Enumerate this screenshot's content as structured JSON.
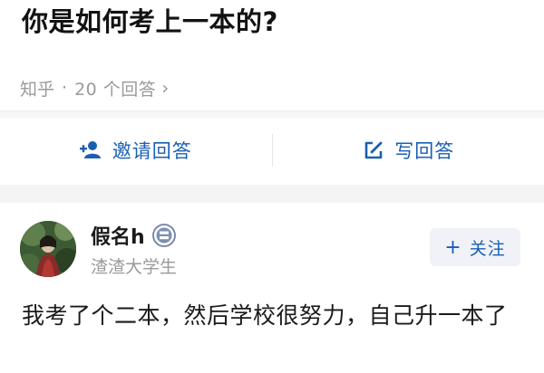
{
  "question": {
    "title": "你是如何考上一本的?",
    "source": "知乎",
    "separator": "·",
    "answer_count": "20 个回答",
    "chevron": "›"
  },
  "actions": {
    "invite_label": "邀请回答",
    "invite_icon": "add-user-icon",
    "write_label": "写回答",
    "write_icon": "edit-icon"
  },
  "answer": {
    "author_name": "假名h",
    "author_badge_icon": "badge-icon",
    "author_headline": "渣渣大学生",
    "follow_label": "关注",
    "follow_prefix": "+",
    "body": "我考了个二本，然后学校很努力，自己升一本了"
  },
  "colors": {
    "accent": "#1a5fb4",
    "muted_text": "#9a9a9a",
    "title_text": "#121212"
  }
}
